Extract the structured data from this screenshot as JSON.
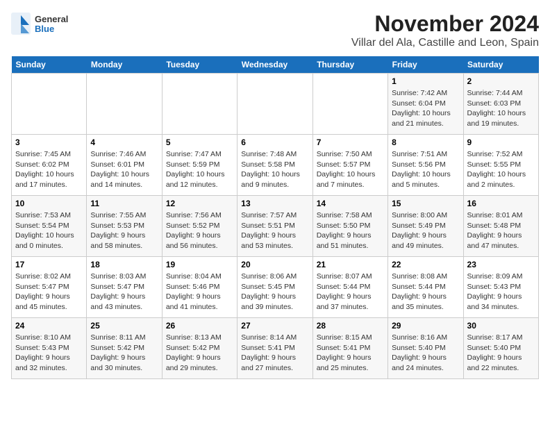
{
  "logo": {
    "general": "General",
    "blue": "Blue"
  },
  "title": "November 2024",
  "location": "Villar del Ala, Castille and Leon, Spain",
  "weekdays": [
    "Sunday",
    "Monday",
    "Tuesday",
    "Wednesday",
    "Thursday",
    "Friday",
    "Saturday"
  ],
  "weeks": [
    [
      {
        "day": "",
        "detail": ""
      },
      {
        "day": "",
        "detail": ""
      },
      {
        "day": "",
        "detail": ""
      },
      {
        "day": "",
        "detail": ""
      },
      {
        "day": "",
        "detail": ""
      },
      {
        "day": "1",
        "detail": "Sunrise: 7:42 AM\nSunset: 6:04 PM\nDaylight: 10 hours\nand 21 minutes."
      },
      {
        "day": "2",
        "detail": "Sunrise: 7:44 AM\nSunset: 6:03 PM\nDaylight: 10 hours\nand 19 minutes."
      }
    ],
    [
      {
        "day": "3",
        "detail": "Sunrise: 7:45 AM\nSunset: 6:02 PM\nDaylight: 10 hours\nand 17 minutes."
      },
      {
        "day": "4",
        "detail": "Sunrise: 7:46 AM\nSunset: 6:01 PM\nDaylight: 10 hours\nand 14 minutes."
      },
      {
        "day": "5",
        "detail": "Sunrise: 7:47 AM\nSunset: 5:59 PM\nDaylight: 10 hours\nand 12 minutes."
      },
      {
        "day": "6",
        "detail": "Sunrise: 7:48 AM\nSunset: 5:58 PM\nDaylight: 10 hours\nand 9 minutes."
      },
      {
        "day": "7",
        "detail": "Sunrise: 7:50 AM\nSunset: 5:57 PM\nDaylight: 10 hours\nand 7 minutes."
      },
      {
        "day": "8",
        "detail": "Sunrise: 7:51 AM\nSunset: 5:56 PM\nDaylight: 10 hours\nand 5 minutes."
      },
      {
        "day": "9",
        "detail": "Sunrise: 7:52 AM\nSunset: 5:55 PM\nDaylight: 10 hours\nand 2 minutes."
      }
    ],
    [
      {
        "day": "10",
        "detail": "Sunrise: 7:53 AM\nSunset: 5:54 PM\nDaylight: 10 hours\nand 0 minutes."
      },
      {
        "day": "11",
        "detail": "Sunrise: 7:55 AM\nSunset: 5:53 PM\nDaylight: 9 hours\nand 58 minutes."
      },
      {
        "day": "12",
        "detail": "Sunrise: 7:56 AM\nSunset: 5:52 PM\nDaylight: 9 hours\nand 56 minutes."
      },
      {
        "day": "13",
        "detail": "Sunrise: 7:57 AM\nSunset: 5:51 PM\nDaylight: 9 hours\nand 53 minutes."
      },
      {
        "day": "14",
        "detail": "Sunrise: 7:58 AM\nSunset: 5:50 PM\nDaylight: 9 hours\nand 51 minutes."
      },
      {
        "day": "15",
        "detail": "Sunrise: 8:00 AM\nSunset: 5:49 PM\nDaylight: 9 hours\nand 49 minutes."
      },
      {
        "day": "16",
        "detail": "Sunrise: 8:01 AM\nSunset: 5:48 PM\nDaylight: 9 hours\nand 47 minutes."
      }
    ],
    [
      {
        "day": "17",
        "detail": "Sunrise: 8:02 AM\nSunset: 5:47 PM\nDaylight: 9 hours\nand 45 minutes."
      },
      {
        "day": "18",
        "detail": "Sunrise: 8:03 AM\nSunset: 5:47 PM\nDaylight: 9 hours\nand 43 minutes."
      },
      {
        "day": "19",
        "detail": "Sunrise: 8:04 AM\nSunset: 5:46 PM\nDaylight: 9 hours\nand 41 minutes."
      },
      {
        "day": "20",
        "detail": "Sunrise: 8:06 AM\nSunset: 5:45 PM\nDaylight: 9 hours\nand 39 minutes."
      },
      {
        "day": "21",
        "detail": "Sunrise: 8:07 AM\nSunset: 5:44 PM\nDaylight: 9 hours\nand 37 minutes."
      },
      {
        "day": "22",
        "detail": "Sunrise: 8:08 AM\nSunset: 5:44 PM\nDaylight: 9 hours\nand 35 minutes."
      },
      {
        "day": "23",
        "detail": "Sunrise: 8:09 AM\nSunset: 5:43 PM\nDaylight: 9 hours\nand 34 minutes."
      }
    ],
    [
      {
        "day": "24",
        "detail": "Sunrise: 8:10 AM\nSunset: 5:43 PM\nDaylight: 9 hours\nand 32 minutes."
      },
      {
        "day": "25",
        "detail": "Sunrise: 8:11 AM\nSunset: 5:42 PM\nDaylight: 9 hours\nand 30 minutes."
      },
      {
        "day": "26",
        "detail": "Sunrise: 8:13 AM\nSunset: 5:42 PM\nDaylight: 9 hours\nand 29 minutes."
      },
      {
        "day": "27",
        "detail": "Sunrise: 8:14 AM\nSunset: 5:41 PM\nDaylight: 9 hours\nand 27 minutes."
      },
      {
        "day": "28",
        "detail": "Sunrise: 8:15 AM\nSunset: 5:41 PM\nDaylight: 9 hours\nand 25 minutes."
      },
      {
        "day": "29",
        "detail": "Sunrise: 8:16 AM\nSunset: 5:40 PM\nDaylight: 9 hours\nand 24 minutes."
      },
      {
        "day": "30",
        "detail": "Sunrise: 8:17 AM\nSunset: 5:40 PM\nDaylight: 9 hours\nand 22 minutes."
      }
    ]
  ]
}
